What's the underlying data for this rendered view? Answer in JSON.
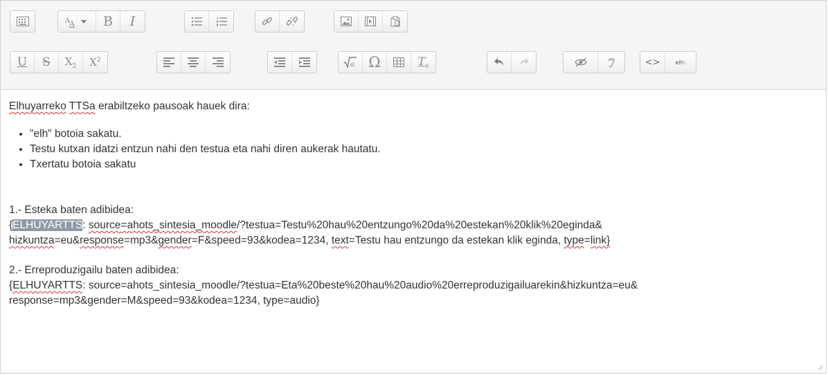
{
  "toolbar": {
    "rows": [
      [
        [
          "toolbar-toggle-icon"
        ],
        [
          "font-color-icon",
          "bold-icon",
          "italic-icon"
        ],
        [
          "bullet-list-icon",
          "numbered-list-icon"
        ],
        [
          "link-icon",
          "unlink-icon"
        ],
        [
          "image-icon",
          "media-icon",
          "manage-files-icon"
        ]
      ],
      [
        [
          "underline-icon",
          "strikethrough-icon",
          "subscript-icon",
          "superscript-icon"
        ],
        [
          "align-left-icon",
          "align-center-icon",
          "align-right-icon"
        ],
        [
          "outdent-icon",
          "indent-icon"
        ],
        [
          "equation-icon",
          "special-character-icon",
          "table-icon",
          "clear-formatting-icon"
        ],
        [
          "undo-icon",
          "redo-icon"
        ],
        [
          "accessibility-checker-icon",
          "screenreader-helper-icon"
        ],
        [
          "html-icon",
          "elh-tts-icon"
        ]
      ]
    ],
    "labels": {
      "bold": "B",
      "italic": "I",
      "underline": "U",
      "strikethrough": "S",
      "subscript": "X",
      "subscript_mark": "2",
      "superscript": "X",
      "superscript_mark": "2",
      "omega": "Ω",
      "clear": "T",
      "clear_mark": "x",
      "html": "<>",
      "elh": "elh"
    }
  },
  "content": {
    "intro": {
      "w1": "Elhuyarreko",
      "w2": "TTSa",
      "rest": " erabiltzeko pausoak hauek dira:"
    },
    "steps": [
      "\"elh\" botoia sakatu.",
      "Testu kutxan idatzi entzun nahi den testua eta nahi diren aukerak hautatu.",
      "Txertatu botoia sakatu"
    ],
    "example1": {
      "title": "1.- Esteka baten adibidea:",
      "l1_open": "{",
      "l1_tag": "ELHUYARTTS",
      "l1_colon": ": ",
      "l1_source_key": "source",
      "l1_source_val": "=ahots_sintesia_moodle",
      "l1_rest": "/?testua=Testu%20hau%20entzungo%20da%20estekan%20klik%20eginda&",
      "l2_a": "hizkuntza",
      "l2_b": "=eu&",
      "l2_c": "response",
      "l2_d": "=mp3&",
      "l2_e": "gender",
      "l2_f": "=F&speed=93&kodea=1234, ",
      "l2_g": "text",
      "l2_h": "=Testu hau entzungo da estekan klik eginda, ",
      "l2_i": "type",
      "l2_j": "=",
      "l2_k": "link}"
    },
    "example2": {
      "title": "2.- Erreproduzigailu baten adibidea:",
      "l1_open": "{",
      "l1_tag": "ELHUYARTTS",
      "l1_rest": ": source=ahots_sintesia_moodle/?testua=Eta%20beste%20hau%20audio%20erreproduzigailuarekin&hizkuntza=eu&",
      "l2": "response=mp3&gender=M&speed=93&kodea=1234, type=audio}"
    }
  }
}
